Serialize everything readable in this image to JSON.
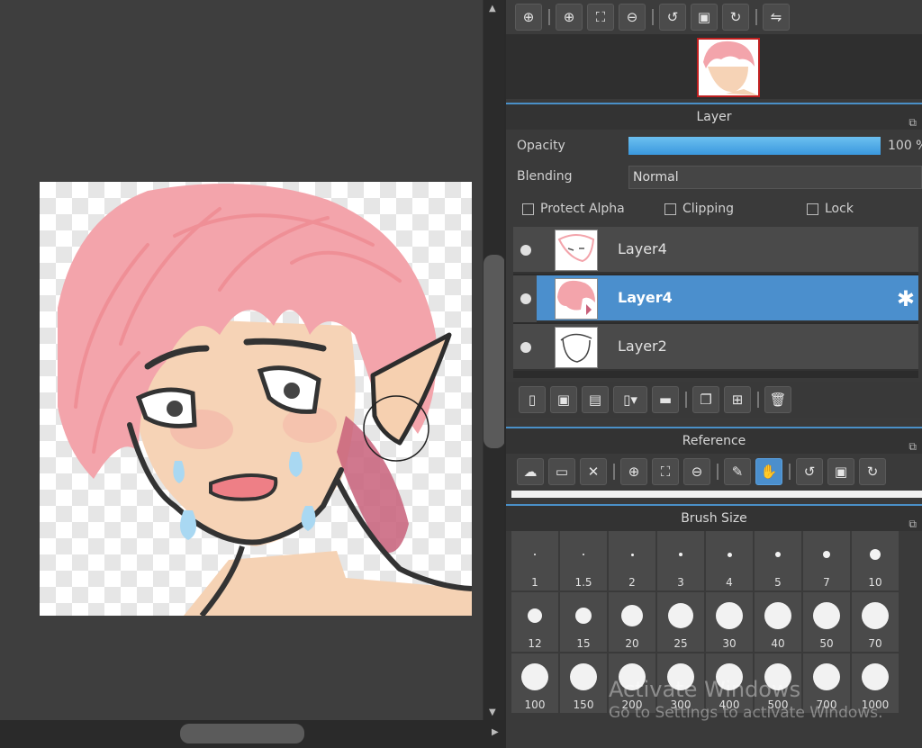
{
  "toolbar": {
    "icons": [
      "zoom-actual-icon",
      "zoom-in-icon",
      "fit-icon",
      "zoom-out-icon",
      "rotate-left-icon",
      "reset-rotate-icon",
      "rotate-right-icon",
      "flip-icon"
    ]
  },
  "layer_panel": {
    "title": "Layer",
    "opacity_label": "Opacity",
    "opacity_value": "100 %",
    "opacity_fraction": 1.0,
    "blending_label": "Blending",
    "blending_value": "Normal",
    "protect_alpha": "Protect Alpha",
    "clipping": "Clipping",
    "lock": "Lock",
    "layers": [
      {
        "name": "Layer4",
        "selected": false
      },
      {
        "name": "Layer4",
        "selected": true
      },
      {
        "name": "Layer2",
        "selected": false
      }
    ]
  },
  "reference_panel": {
    "title": "Reference"
  },
  "brush_panel": {
    "title": "Brush Size",
    "sizes": [
      "1",
      "1.5",
      "2",
      "3",
      "4",
      "5",
      "7",
      "10",
      "12",
      "15",
      "20",
      "25",
      "30",
      "40",
      "50",
      "70",
      "100",
      "150",
      "200",
      "300",
      "400",
      "500",
      "700",
      "1000"
    ]
  },
  "watermark": {
    "line1": "Activate Windows",
    "line2": "Go to Settings to activate Windows."
  },
  "colors": {
    "accent": "#4b8fcd",
    "hair": "#f4a5ab",
    "skin": "#f6d3b6"
  }
}
